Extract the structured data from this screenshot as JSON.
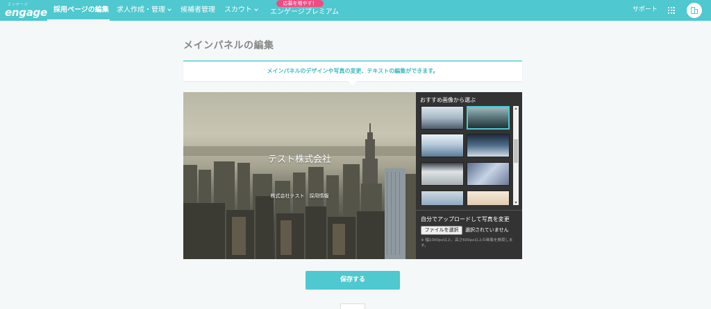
{
  "header": {
    "logo_ruby": "エンゲージ",
    "logo_text": "engage",
    "nav": [
      {
        "label": "採用ページの編集"
      },
      {
        "label": "求人作成・管理"
      },
      {
        "label": "候補者管理"
      },
      {
        "label": "スカウト"
      },
      {
        "label": "エンゲージプレミアム"
      }
    ],
    "promo_badge": "応募を増やす！",
    "support": "サポート",
    "colors": {
      "header_bg": "#4fc8cf",
      "badge": "#f04c84"
    }
  },
  "main": {
    "title": "メインパネルの編集",
    "info": "メインパネルのデザインや写真の変更、テキストの編集ができます。",
    "preview": {
      "company_name": "テスト株式会社",
      "company_sub": "株式会社テスト　採用情報"
    },
    "side": {
      "recommended_title": "おすすめ画像から選ぶ",
      "upload_title": "自分でアップロードして写真を変更",
      "file_button": "ファイルを選択",
      "file_status": "選択されていません",
      "upload_note": "※ 幅1000px以上、高さ600px以上の画像を推奨します。"
    },
    "save_button": "保存する"
  }
}
